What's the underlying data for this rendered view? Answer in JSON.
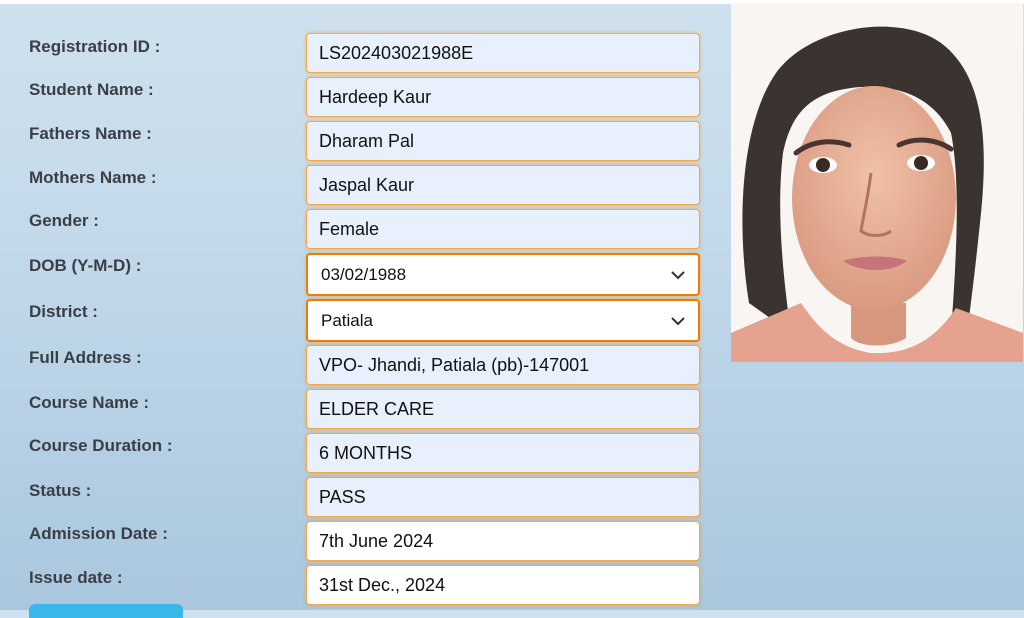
{
  "form": {
    "fields": [
      {
        "label": "Registration ID :",
        "value": "LS202403021988E"
      },
      {
        "label": "Student Name :",
        "value": "Hardeep Kaur"
      },
      {
        "label": "Fathers Name :",
        "value": "Dharam Pal"
      },
      {
        "label": "Mothers Name :",
        "value": "Jaspal Kaur"
      },
      {
        "label": "Gender :",
        "value": "Female"
      },
      {
        "label": "DOB (Y-M-D) :",
        "value": "03/02/1988"
      },
      {
        "label": "District :",
        "value": "Patiala"
      },
      {
        "label": "Full Address :",
        "value": "VPO- Jhandi, Patiala (pb)-147001"
      },
      {
        "label": "Course Name :",
        "value": "ELDER CARE"
      },
      {
        "label": "Course Duration :",
        "value": "6 MONTHS"
      },
      {
        "label": "Status :",
        "value": "PASS"
      },
      {
        "label": "Admission Date :",
        "value": "7th June 2024"
      },
      {
        "label": "Issue date :",
        "value": "31st Dec., 2024"
      }
    ]
  },
  "icons": {
    "dropdown": "chevron-down-icon"
  },
  "colors": {
    "field_border": "#f3a84a",
    "select_border": "#f07d00",
    "field_bg": "#e8f0fe",
    "button": "#38b7e8"
  }
}
